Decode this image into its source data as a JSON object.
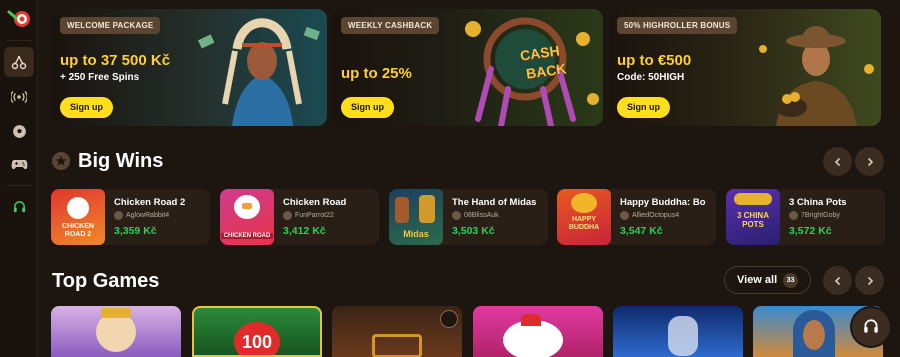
{
  "promos": [
    {
      "badge": "WELCOME PACKAGE",
      "title": "up to 37 500 Kč",
      "sub": "+ 250 Free Spins",
      "button": "Sign up"
    },
    {
      "badge": "WEEKLY CASHBACK",
      "title": "up to 25%",
      "sub": "",
      "button": "Sign up",
      "art_text": [
        "CASH",
        "BACK"
      ]
    },
    {
      "badge": "50% HIGHROLLER BONUS",
      "title": "up to €500",
      "sub": "Code: 50HIGH",
      "button": "Sign up"
    }
  ],
  "big_wins": {
    "title": "Big Wins",
    "items": [
      {
        "game": "Chicken Road 2",
        "user": "AglowRabbit4",
        "amount": "3,359 Kč",
        "thumb_text": "CHICKEN ROAD 2"
      },
      {
        "game": "Chicken Road",
        "user": "FunParrot22",
        "amount": "3,412 Kč",
        "thumb_text": "CHICKEN ROAD"
      },
      {
        "game": "The Hand of Midas",
        "user": "08BlissAuk",
        "amount": "3,503 Kč",
        "thumb_text": "Midas"
      },
      {
        "game": "Happy Buddha: Bo",
        "user": "AlliedOctopus4",
        "amount": "3,547 Kč",
        "thumb_text": "HAPPY BUDDHA"
      },
      {
        "game": "3 China Pots",
        "user": "7BrightGoby",
        "amount": "3,572 Kč",
        "thumb_text": "3 CHINA POTS"
      }
    ]
  },
  "top_games": {
    "title": "Top Games",
    "view_all": "View all",
    "count": "33",
    "tile_texts": [
      "",
      "100",
      "",
      "",
      "",
      ""
    ]
  },
  "colors": {
    "accent_yellow": "#ffdf1b",
    "amount_green": "#29d15b",
    "background": "#1d150f"
  },
  "icons": [
    "cherry-icon",
    "broadcast-icon",
    "soccer-ball-icon",
    "gamepad-icon",
    "headset-icon",
    "chevron-left-icon",
    "chevron-right-icon",
    "star-icon"
  ]
}
